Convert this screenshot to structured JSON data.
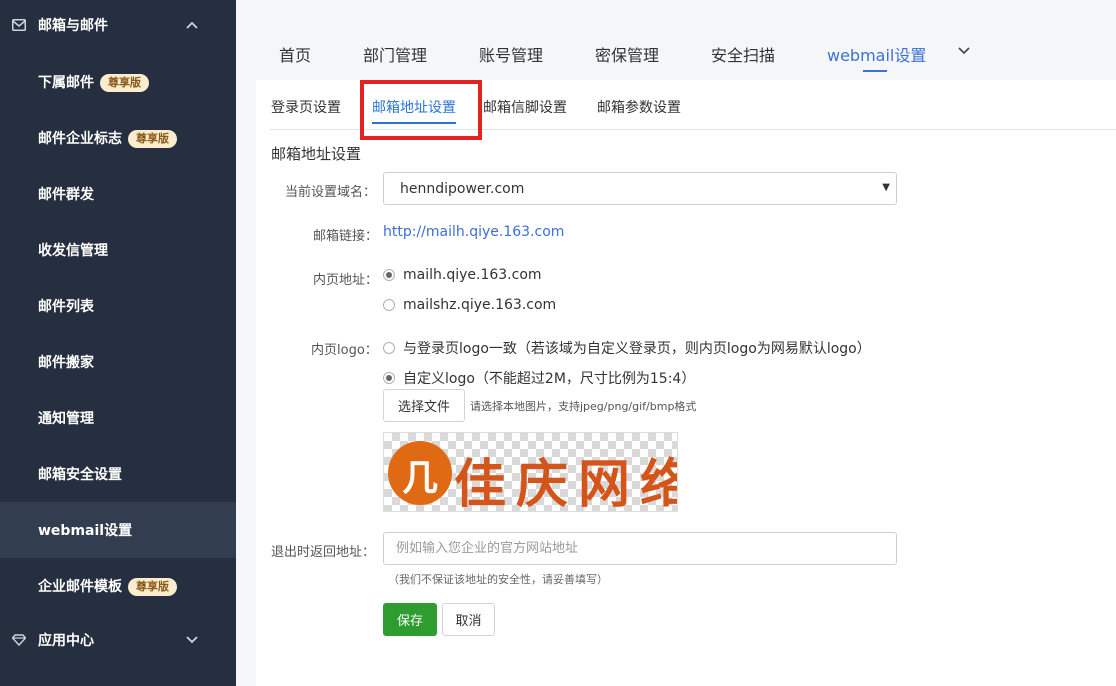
{
  "sidebar": {
    "section_mail": {
      "label": "邮箱与邮件",
      "icon": "mail-icon",
      "chevron": "chevron-up-icon"
    },
    "items": [
      {
        "label": "下属邮件",
        "badge": "尊享版"
      },
      {
        "label": "邮件企业标志",
        "badge": "尊享版"
      },
      {
        "label": "邮件群发"
      },
      {
        "label": "收发信管理"
      },
      {
        "label": "邮件列表"
      },
      {
        "label": "邮件搬家"
      },
      {
        "label": "通知管理"
      },
      {
        "label": "邮箱安全设置"
      },
      {
        "label": "webmail设置"
      },
      {
        "label": "企业邮件模板",
        "badge": "尊享版"
      }
    ],
    "section_apps": {
      "label": "应用中心",
      "icon": "diamond-icon",
      "chevron": "chevron-down-icon"
    }
  },
  "top_tabs": [
    "首页",
    "部门管理",
    "账号管理",
    "密保管理",
    "安全扫描",
    "webmail设置"
  ],
  "top_active": "webmail设置",
  "sub_tabs": [
    "登录页设置",
    "邮箱地址设置",
    "邮箱信脚设置",
    "邮箱参数设置"
  ],
  "sub_active": "邮箱地址设置",
  "form": {
    "section_title": "邮箱地址设置",
    "domain_label": "当前设置域名：",
    "domain_value": "henndipower.com",
    "link_label": "邮箱链接：",
    "link_value": "http://mailh.qiye.163.com",
    "inner_addr_label": "内页地址：",
    "inner_addr_options": [
      {
        "label": "mailh.qiye.163.com",
        "checked": true
      },
      {
        "label": "mailshz.qiye.163.com",
        "checked": false
      }
    ],
    "inner_logo_label": "内页logo：",
    "inner_logo_options": [
      {
        "label": "与登录页logo一致（若该域为自定义登录页，则内页logo为网易默认logo）",
        "checked": false
      },
      {
        "label": "自定义logo（不能超过2M，尺寸比例为15:4）",
        "checked": true
      }
    ],
    "file_button": "选择文件",
    "file_hint": "请选择本地图片，支持jpeg/png/gif/bmp格式",
    "logo_preview_text": "佳庆网络",
    "logo_mark_text": "几",
    "logout_label": "退出时返回地址：",
    "logout_placeholder": "例如输入您企业的官方网站地址",
    "logout_note": "（我们不保证该地址的安全性，请妥善填写）",
    "save_button": "保存",
    "cancel_button": "取消"
  },
  "colors": {
    "sidebar_bg": "#252f3f",
    "accent_blue": "#3d6fd9",
    "save_green": "#2f9c2f",
    "highlight_red": "#e52222",
    "badge_bg": "#fbeccd"
  }
}
